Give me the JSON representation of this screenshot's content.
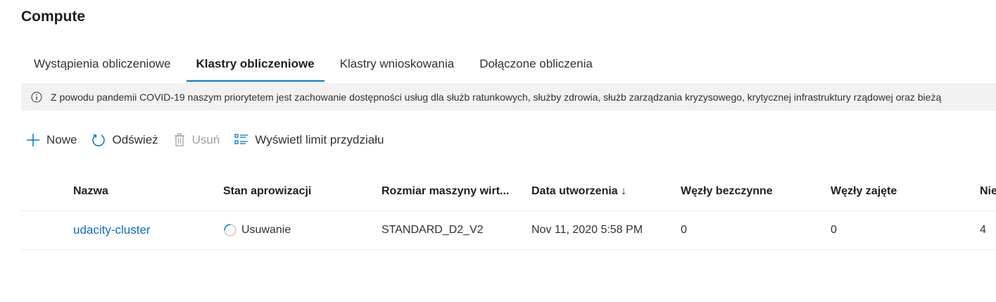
{
  "page": {
    "title": "Compute"
  },
  "tabs": [
    {
      "label": "Wystąpienia obliczeniowe",
      "active": false
    },
    {
      "label": "Klastry obliczeniowe",
      "active": true
    },
    {
      "label": "Klastry wnioskowania",
      "active": false
    },
    {
      "label": "Dołączone obliczenia",
      "active": false
    }
  ],
  "banner": {
    "icon": "info-icon",
    "text": "Z powodu pandemii COVID-19 naszym priorytetem jest zachowanie dostępności usług dla służb ratunkowych, służby zdrowia, służb zarządzania kryzysowego, krytycznej infrastruktury rządowej oraz bieżą"
  },
  "toolbar": {
    "new_label": "Nowe",
    "refresh_label": "Odśwież",
    "delete_label": "Usuń",
    "quota_label": "Wyświetl limit przydziału"
  },
  "table": {
    "headers": [
      "Nazwa",
      "Stan aprowizacji",
      "Rozmiar maszyny wirt...",
      "Data utworzenia ↓",
      "Węzły bezczynne",
      "Węzły zajęte",
      "Nie"
    ],
    "rows": [
      [
        "udacity-cluster",
        "Usuwanie",
        "STANDARD_D2_V2",
        "Nov 11, 2020 5:58 PM",
        "0",
        "0",
        "4"
      ]
    ]
  },
  "colors": {
    "accent": "#0078d4",
    "link": "#0f6cbd",
    "banner_bg": "#f3f2f1"
  }
}
